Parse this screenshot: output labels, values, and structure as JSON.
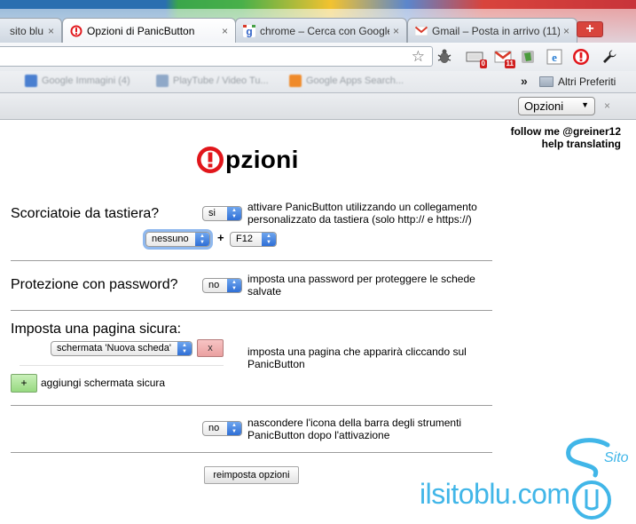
{
  "tabs": [
    {
      "title": "sito blu",
      "active": false
    },
    {
      "title": "Opzioni di PanicButton",
      "active": true
    },
    {
      "title": "chrome – Cerca con Google",
      "active": false
    },
    {
      "title": "Gmail – Posta in arrivo (11)",
      "active": false
    }
  ],
  "tab_close": "×",
  "new_tab": "+",
  "toolbar": {
    "star": "☆",
    "badges": {
      "download": "0",
      "gmail": "11"
    }
  },
  "bookmarks": {
    "items": [
      "Google Immagini (4)",
      "PlayTube / Video Tu...",
      "Google Apps Search..."
    ],
    "chevrons": "»",
    "other": "Altri Preferiti"
  },
  "optionsbar": {
    "select": "Opzioni",
    "close": "×"
  },
  "follow": {
    "line1": "follow me @greiner12",
    "line2": "help translating"
  },
  "page_title": "pzioni",
  "shortcuts": {
    "label": "Scorciatoie da tastiera?",
    "value": "si",
    "desc_line1": "attivare PanicButton utilizzando un collegamento",
    "desc_line2": "personalizzato da tastiera (solo http:// e https://)",
    "modifier": "nessuno",
    "plus": "+",
    "key": "F12"
  },
  "password": {
    "label": "Protezione con password?",
    "value": "no",
    "desc_line1": "imposta una password per proteggere le schede",
    "desc_line2": "salvate"
  },
  "safepage": {
    "label": "Imposta una pagina sicura:",
    "select": "schermata 'Nuova scheda'",
    "remove": "x",
    "desc_line1": "imposta una pagina che apparirà cliccando sul",
    "desc_line2": "PanicButton",
    "add_button": "+",
    "add_label": "aggiungi schermata sicura"
  },
  "hideicon": {
    "value": "no",
    "desc_line1": "nascondere l'icona della barra degli strumenti",
    "desc_line2": "PanicButton dopo l'attivazione"
  },
  "reset_button": "reimposta opzioni",
  "watermark": {
    "text": "ilsitoblu.com",
    "logo_text": "Sito",
    "color": "#41b6e8"
  },
  "colors": {
    "panic_red": "#e1161b"
  }
}
